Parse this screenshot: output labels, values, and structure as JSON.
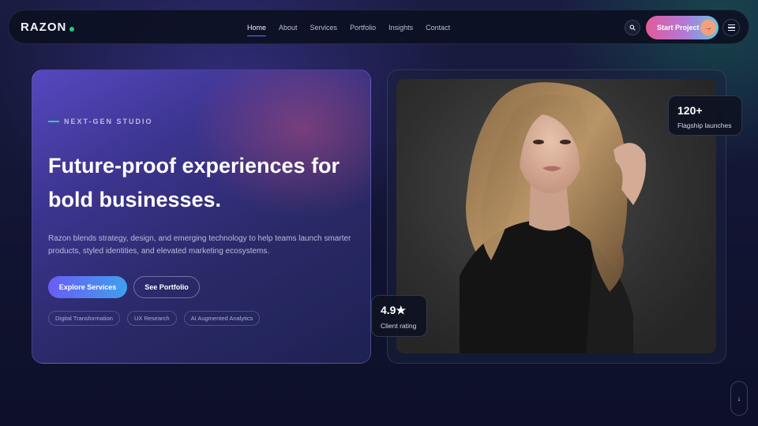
{
  "brand": {
    "name": "RAZON",
    "accent": "#27c97f"
  },
  "nav": {
    "links": [
      "Home",
      "About",
      "Services",
      "Portfolio",
      "Insights",
      "Contact"
    ],
    "active": "Home",
    "search_icon": "search-icon",
    "cta_label": "Start Project",
    "cta_icon": "arrow-right-icon",
    "menu_icon": "hamburger-menu-icon"
  },
  "hero": {
    "eyebrow": "NEXT-GEN STUDIO",
    "title_line1": "Future-proof experiences for",
    "title_line2": "bold businesses.",
    "description_line1": "Razon blends strategy, design, and emerging technology to help teams launch smarter",
    "description_line2": "products, styled identities, and elevated marketing ecosystems.",
    "primary_button": "Explore Services",
    "secondary_button": "See Portfolio",
    "chips": [
      "Digital Transformation",
      "UX Research",
      "AI Augmented Analytics"
    ]
  },
  "stats": {
    "top": {
      "value": "120+",
      "label": "Flagship launches"
    },
    "bottom": {
      "value": "4.9★",
      "label": "Client rating"
    }
  },
  "scroll": {
    "icon": "arrow-down-icon",
    "glyph": "↓"
  },
  "colors": {
    "primary_gradient_start": "#6a5cf5",
    "primary_gradient_end": "#3fa0ee",
    "cta_gradient": [
      "#e35a9a",
      "#b07ad8",
      "#63c7e0"
    ],
    "eyebrow_line": "#3fc6a8",
    "active_underline": "#4f7bff"
  }
}
